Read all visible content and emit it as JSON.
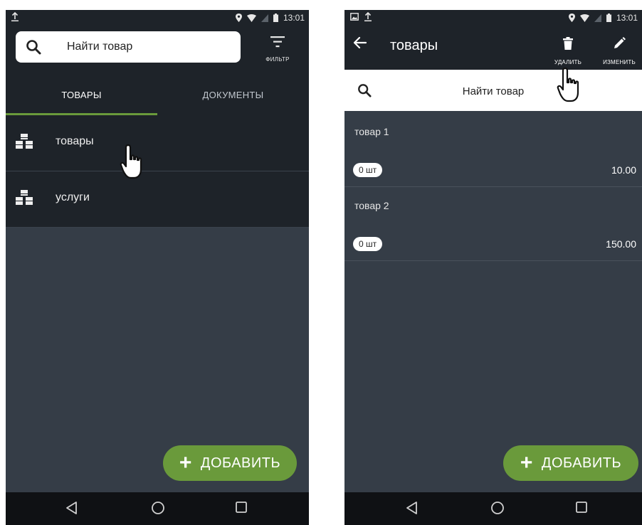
{
  "left_screen": {
    "status": {
      "time": "13:01"
    },
    "search": {
      "placeholder": "Найти товар"
    },
    "filter": {
      "label": "ФИЛЬТР"
    },
    "tabs": [
      {
        "label": "ТОВАРЫ",
        "active": true
      },
      {
        "label": "ДОКУМЕНТЫ",
        "active": false
      }
    ],
    "categories": [
      {
        "label": "товары",
        "icon": "category-boxes-icon"
      },
      {
        "label": "услуги",
        "icon": "category-boxes-icon"
      }
    ],
    "fab": {
      "label": "ДОБАВИТЬ",
      "icon": "plus-icon"
    }
  },
  "right_screen": {
    "status": {
      "time": "13:01"
    },
    "appbar": {
      "title": "товары",
      "actions": [
        {
          "label": "УДАЛИТЬ",
          "icon": "trash-icon"
        },
        {
          "label": "ИЗМЕНИТЬ",
          "icon": "pencil-icon"
        }
      ]
    },
    "search": {
      "placeholder": "Найти товар"
    },
    "products": [
      {
        "name": "товар 1",
        "qty": "0 шт",
        "price": "10.00"
      },
      {
        "name": "товар 2",
        "qty": "0 шт",
        "price": "150.00"
      }
    ],
    "fab": {
      "label": "ДОБАВИТЬ",
      "icon": "plus-icon"
    }
  },
  "colors": {
    "accent": "#6a9a3b",
    "appbar_bg": "#1e2329",
    "content_bg": "#353d47",
    "navbar_bg": "#0f1114"
  }
}
